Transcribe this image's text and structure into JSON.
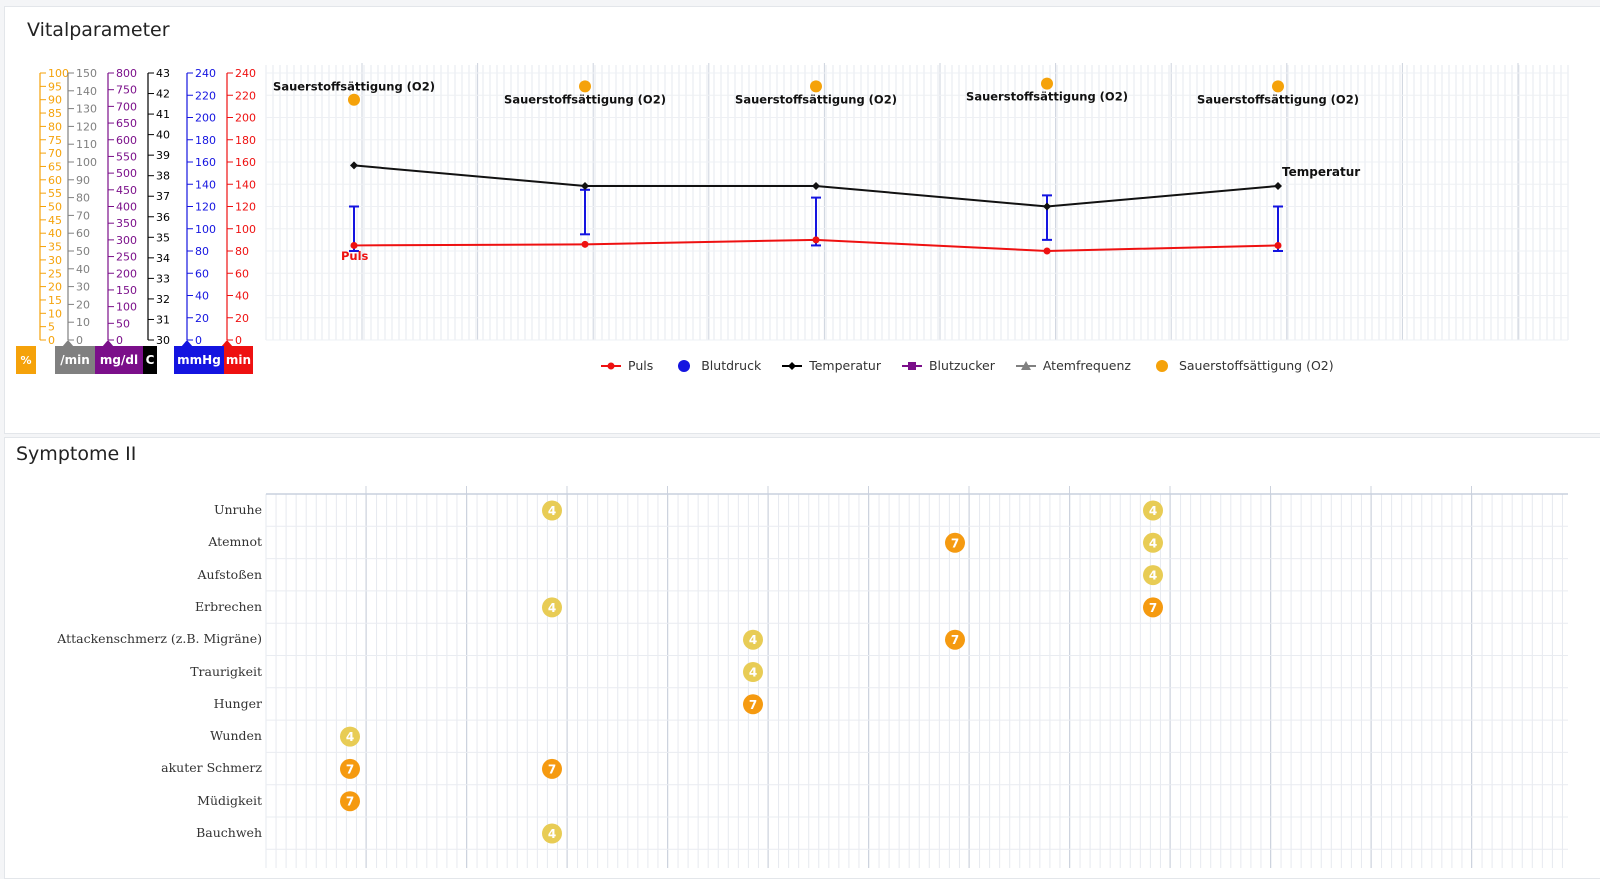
{
  "vital": {
    "title": "Vitalparameter",
    "axes": [
      {
        "key": "percent",
        "color": "#f5a20a",
        "ticks": [
          "100",
          "95",
          "90",
          "85",
          "80",
          "75",
          "70",
          "65",
          "60",
          "55",
          "50",
          "45",
          "40",
          "35",
          "30",
          "25",
          "20",
          "15",
          "10",
          "5",
          "0"
        ],
        "unit": "%"
      },
      {
        "key": "resp",
        "color": "#808080",
        "ticks": [
          "150",
          "140",
          "130",
          "120",
          "110",
          "100",
          "90",
          "80",
          "70",
          "60",
          "50",
          "40",
          "30",
          "20",
          "10",
          "0"
        ],
        "unit": "/min"
      },
      {
        "key": "sugar",
        "color": "#7b0f8a",
        "ticks": [
          "800",
          "750",
          "700",
          "650",
          "600",
          "550",
          "500",
          "450",
          "400",
          "350",
          "300",
          "250",
          "200",
          "150",
          "100",
          "50",
          "0"
        ],
        "unit": "mg/dl"
      },
      {
        "key": "temp",
        "color": "#000000",
        "ticks": [
          "43",
          "42",
          "41",
          "40",
          "39",
          "38",
          "37",
          "36",
          "35",
          "34",
          "33",
          "32",
          "31",
          "30"
        ],
        "unit": "C"
      },
      {
        "key": "bp",
        "color": "#1414e0",
        "ticks": [
          "240",
          "220",
          "200",
          "180",
          "160",
          "140",
          "120",
          "100",
          "80",
          "60",
          "40",
          "20",
          "0"
        ],
        "unit": "mmHg"
      },
      {
        "key": "pulse",
        "color": "#ee1111",
        "ticks": [
          "240",
          "220",
          "200",
          "180",
          "160",
          "140",
          "120",
          "100",
          "80",
          "60",
          "40",
          "20",
          "0"
        ],
        "unit": "min"
      }
    ],
    "labels": {
      "o2": "Sauerstoffsättigung (O2)",
      "temp": "Temperatur",
      "pulse": "Puls"
    },
    "legend": [
      {
        "name": "Puls",
        "color": "#ee1111",
        "marker": "line-dot"
      },
      {
        "name": "Blutdruck",
        "color": "#1414e0",
        "marker": "dot"
      },
      {
        "name": "Temperatur",
        "color": "#000000",
        "marker": "line-diamond"
      },
      {
        "name": "Blutzucker",
        "color": "#7b0f8a",
        "marker": "line-square"
      },
      {
        "name": "Atemfrequenz",
        "color": "#808080",
        "marker": "line-triangle"
      },
      {
        "name": "Sauerstoffsättigung (O2)",
        "color": "#f5a20a",
        "marker": "dot"
      }
    ]
  },
  "chart_data": {
    "type": "line",
    "x_slots": [
      1,
      2,
      3,
      4,
      5
    ],
    "series": [
      {
        "name": "Puls",
        "axis": "pulse",
        "values": [
          85,
          86,
          90,
          80,
          85
        ]
      },
      {
        "name": "Temperatur",
        "axis": "temp",
        "values": [
          38.5,
          37.5,
          37.5,
          36.5,
          37.5
        ]
      },
      {
        "name": "Blutdruck",
        "axis": "bp",
        "type": "range",
        "values": [
          [
            80,
            120
          ],
          [
            95,
            135
          ],
          [
            85,
            128
          ],
          [
            90,
            130
          ],
          [
            80,
            120
          ]
        ]
      },
      {
        "name": "Sauerstoffsättigung (O2)",
        "axis": "percent",
        "values": [
          90,
          95,
          95,
          96,
          95
        ]
      }
    ]
  },
  "symptoms": {
    "title": "Symptome II",
    "rows": [
      "Unruhe",
      "Atemnot",
      "Aufstoßen",
      "Erbrechen",
      "Attackenschmerz (z.B. Migräne)",
      "Traurigkeit",
      "Hunger",
      "Wunden",
      "akuter Schmerz",
      "Müdigkeit",
      "Bauchweh"
    ],
    "markers": [
      {
        "row": 0,
        "col": 2,
        "value": "4"
      },
      {
        "row": 0,
        "col": 6,
        "value": "4"
      },
      {
        "row": 1,
        "col": 5,
        "value": "7"
      },
      {
        "row": 1,
        "col": 6,
        "value": "4"
      },
      {
        "row": 2,
        "col": 6,
        "value": "4"
      },
      {
        "row": 3,
        "col": 2,
        "value": "4"
      },
      {
        "row": 3,
        "col": 6,
        "value": "7"
      },
      {
        "row": 4,
        "col": 3,
        "value": "4"
      },
      {
        "row": 4,
        "col": 5,
        "value": "7"
      },
      {
        "row": 5,
        "col": 3,
        "value": "4"
      },
      {
        "row": 6,
        "col": 3,
        "value": "7"
      },
      {
        "row": 7,
        "col": 1,
        "value": "4"
      },
      {
        "row": 8,
        "col": 1,
        "value": "7"
      },
      {
        "row": 8,
        "col": 2,
        "value": "7"
      },
      {
        "row": 9,
        "col": 1,
        "value": "7"
      },
      {
        "row": 10,
        "col": 2,
        "value": "4"
      }
    ],
    "colors": {
      "4": "#e8cc55",
      "7": "#f59a10"
    }
  }
}
